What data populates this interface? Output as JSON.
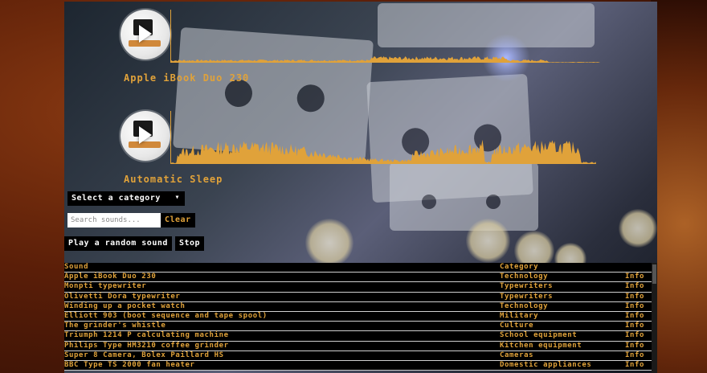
{
  "players": [
    {
      "title": "Apple iBook Duo 230"
    },
    {
      "title": "Automatic Sleep"
    }
  ],
  "controls": {
    "category_select": "Select a category",
    "search_placeholder": "Search sounds...",
    "clear_label": "Clear",
    "random_label": "Play a random sound",
    "stop_label": "Stop"
  },
  "table": {
    "headers": {
      "sound": "Sound",
      "category": "Category"
    },
    "rows": [
      {
        "sound": "Apple iBook Duo 230",
        "category": "Technology",
        "info": "Info"
      },
      {
        "sound": "Monpti typewriter",
        "category": "Typewriters",
        "info": "Info"
      },
      {
        "sound": "Olivetti Dora typewriter",
        "category": "Typewriters",
        "info": "Info"
      },
      {
        "sound": "Winding up a pocket watch",
        "category": "Technology",
        "info": "Info"
      },
      {
        "sound": "Elliott 903 (boot sequence and tape spool)",
        "category": "Military",
        "info": "Info"
      },
      {
        "sound": "The grinder's whistle",
        "category": "Culture",
        "info": "Info"
      },
      {
        "sound": "Triumph 1214 P calculating machine",
        "category": "School equipment",
        "info": "Info"
      },
      {
        "sound": "Philips Type HM3210 coffee grinder",
        "category": "Kitchen equipment",
        "info": "Info"
      },
      {
        "sound": "Super 8 Camera, Bolex Paillard HS",
        "category": "Cameras",
        "info": "Info"
      },
      {
        "sound": "BBC Type TS 2000 fan heater",
        "category": "Domestic appliances",
        "info": "Info"
      }
    ]
  },
  "colors": {
    "accent": "#e0a23a",
    "row_bg": "#000000"
  }
}
